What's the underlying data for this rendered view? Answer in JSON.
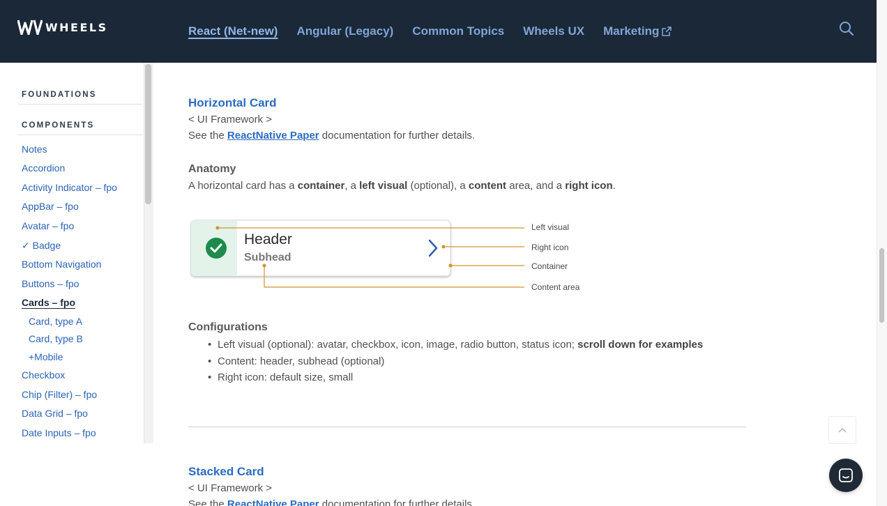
{
  "brand": {
    "name": "WHEELS"
  },
  "nav": {
    "items": [
      {
        "label": "React (Net-new)"
      },
      {
        "label": "Angular (Legacy)"
      },
      {
        "label": "Common Topics"
      },
      {
        "label": "Wheels UX"
      },
      {
        "label": "Marketing"
      }
    ]
  },
  "sidebar": {
    "foundations": "FOUNDATIONS",
    "components": "COMPONENTS",
    "items": [
      {
        "label": "Notes"
      },
      {
        "label": "Accordion"
      },
      {
        "label": "Activity Indicator – fpo"
      },
      {
        "label": "AppBar – fpo"
      },
      {
        "label": "Avatar – fpo"
      },
      {
        "label": "✓ Badge"
      },
      {
        "label": "Bottom Navigation"
      },
      {
        "label": "Buttons – fpo"
      },
      {
        "label": "Cards – fpo"
      },
      {
        "label": "Card, type A"
      },
      {
        "label": "Card, type B"
      },
      {
        "label": "+Mobile"
      },
      {
        "label": "Checkbox"
      },
      {
        "label": "Chip (Filter) – fpo"
      },
      {
        "label": "Data Grid – fpo"
      },
      {
        "label": "Date Inputs – fpo"
      }
    ]
  },
  "content": {
    "horizontal": {
      "title": "Horizontal Card",
      "framework": "< UI Framework >",
      "see_pre": "See the ",
      "see_link": "ReactNative Paper",
      "see_post": " documentation for further details."
    },
    "anatomy": {
      "title": "Anatomy",
      "t1": "A horizontal card has a ",
      "b1": "container",
      "t2": ", a ",
      "b2": "left visual",
      "t3": " (optional), a ",
      "b3": "content",
      "t4": " area, and a ",
      "b4": "right icon",
      "t5": "."
    },
    "diagram": {
      "header": "Header",
      "subhead": "Subhead",
      "labels": {
        "left_visual": "Left visual",
        "right_icon": "Right icon",
        "container": "Container",
        "content_area": "Content area"
      }
    },
    "configurations": {
      "title": "Configurations",
      "b1_text": "Left visual (optional): avatar, checkbox, icon, image, radio button, status icon; ",
      "b1_bold": "scroll down for examples",
      "b2": "Content: header, subhead (optional)",
      "b3": "Right icon: default size, small"
    },
    "stacked": {
      "title": "Stacked Card",
      "framework": "< UI Framework >",
      "see_pre": "See the ",
      "see_link": "ReactNative Paper",
      "see_post": " documentation for further details."
    }
  },
  "colors": {
    "header_bg": "#1b2838",
    "nav_link": "#7fa6d6",
    "link": "#2b6cc2",
    "callout": "#d4922a",
    "success": "#1e8a4c"
  }
}
